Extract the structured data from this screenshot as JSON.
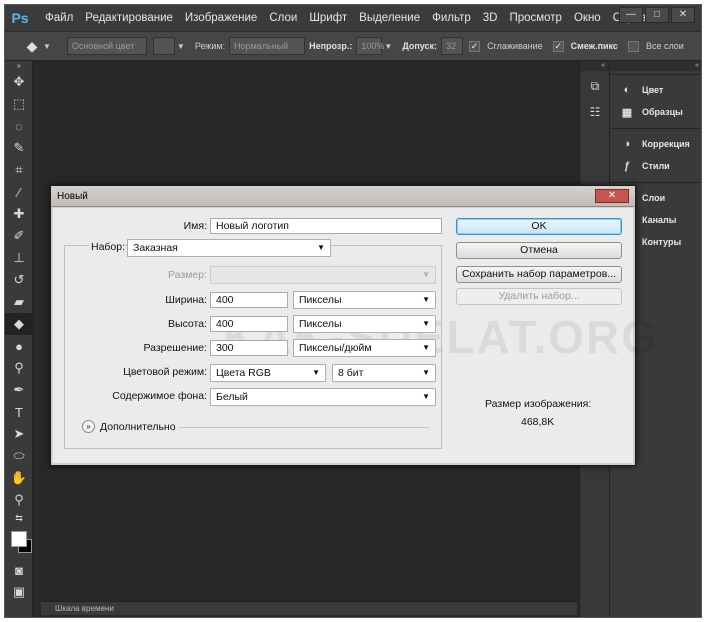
{
  "app": {
    "logo": "Ps",
    "menu": [
      "Файл",
      "Редактирование",
      "Изображение",
      "Слои",
      "Шрифт",
      "Выделение",
      "Фильтр",
      "3D",
      "Просмотр",
      "Окно",
      "Справка"
    ],
    "window_buttons": [
      "—",
      "□",
      "✕"
    ]
  },
  "options_bar": {
    "source_value": "Основной цвет",
    "mode_label": "Режим:",
    "mode_value": "Нормальный",
    "opacity_label": "Непрозр.:",
    "opacity_value": "100%",
    "tolerance_label": "Допуск:",
    "tolerance_value": "32",
    "antialias_label": "Сглаживание",
    "contiguous_label": "Смеж.пикс",
    "all_layers_label": "Все слои"
  },
  "panels": {
    "items": [
      {
        "label": "Цвет",
        "icon": "color-wheel-icon"
      },
      {
        "label": "Образцы",
        "icon": "swatches-grid-icon"
      },
      {
        "label": "Коррекция",
        "icon": "adjustments-icon"
      },
      {
        "label": "Стили",
        "icon": "fx-styles-icon"
      },
      {
        "label": "Слои",
        "icon": "layers-icon"
      },
      {
        "label": "Каналы",
        "icon": "channels-icon"
      },
      {
        "label": "Контуры",
        "icon": "paths-icon"
      }
    ]
  },
  "timeline": {
    "label": "Шкала времени"
  },
  "dialog": {
    "title": "Новый",
    "close": "✕",
    "name_label": "Имя:",
    "name_value": "Новый логотип",
    "preset_label": "Набор:",
    "preset_value": "Заказная",
    "size_label": "Размер:",
    "size_value": "",
    "width_label": "Ширина:",
    "width_value": "400",
    "width_unit": "Пикселы",
    "height_label": "Высота:",
    "height_value": "400",
    "height_unit": "Пикселы",
    "resolution_label": "Разрешение:",
    "resolution_value": "300",
    "resolution_unit": "Пикселы/дюйм",
    "color_mode_label": "Цветовой режим:",
    "color_mode_value": "Цвета RGB",
    "bit_depth_value": "8 бит",
    "background_label": "Содержимое фона:",
    "background_value": "Белый",
    "advanced_label": "Дополнительно",
    "ok_label": "OK",
    "cancel_label": "Отмена",
    "save_preset_label": "Сохранить набор параметров...",
    "delete_preset_label": "Удалить набор...",
    "image_size_label": "Размер изображения:",
    "image_size_value": "468,8K"
  },
  "watermark": "KAK-SDELAT.ORG"
}
